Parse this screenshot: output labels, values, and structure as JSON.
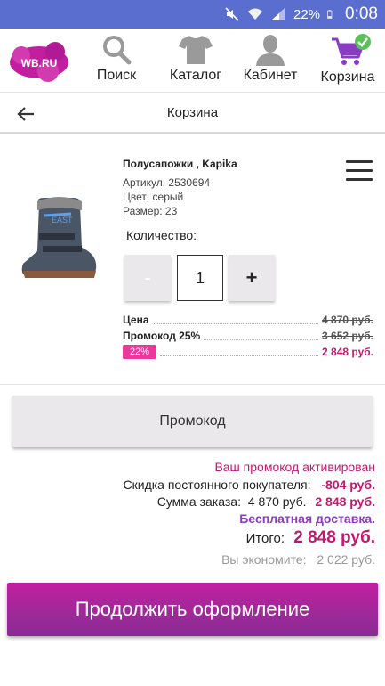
{
  "status_bar": {
    "battery_percent": "22%",
    "time": "0:08",
    "icons": [
      "mute-icon",
      "wifi-icon",
      "signal-icon",
      "battery-icon"
    ],
    "background": "#5a6ed0"
  },
  "nav": {
    "logo": "WB.RU",
    "items": [
      {
        "label": "Поиск",
        "icon": "search-icon"
      },
      {
        "label": "Каталог",
        "icon": "tshirt-icon"
      },
      {
        "label": "Кабинет",
        "icon": "user-icon"
      },
      {
        "label": "Корзина",
        "icon": "cart-icon"
      }
    ]
  },
  "page_header": {
    "title": "Корзина",
    "back_icon": "arrow-left-icon"
  },
  "product": {
    "name": "Полусапожки , Kapika",
    "article": "Артикул: 2530694",
    "color": "Цвет: серый",
    "size": "Размер: 23",
    "quantity_label": "Количество:",
    "quantity": "1",
    "minus_label": "-",
    "plus_label": "+",
    "price_label": "Цена",
    "price_value": "4 870 руб.",
    "promo_label": "Промокод 25%",
    "promo_value": "3 652 руб.",
    "discount_badge": "22%",
    "final_value": "2 848 руб."
  },
  "promo_button": "Промокод",
  "summary": {
    "activated": "Ваш промокод активирован",
    "loyal_label": "Скидка постоянного покупателя:",
    "loyal_value": "-804 руб.",
    "order_label": "Сумма заказа:",
    "order_old": "4 870 руб.",
    "order_new": "2 848 руб.",
    "delivery": "Бесплатная доставка.",
    "total_label": "Итого:",
    "total_value": "2 848 руб.",
    "save_label": "Вы экономите:",
    "save_value": "2 022 руб."
  },
  "checkout_button": "Продолжить оформление",
  "colors": {
    "accent_pink": "#c2196e",
    "badge_pink": "#e83a9a",
    "delivery_purple": "#8a3cc2",
    "checkout_gradient_top": "#c21fa0",
    "checkout_gradient_bottom": "#8a2a96"
  }
}
